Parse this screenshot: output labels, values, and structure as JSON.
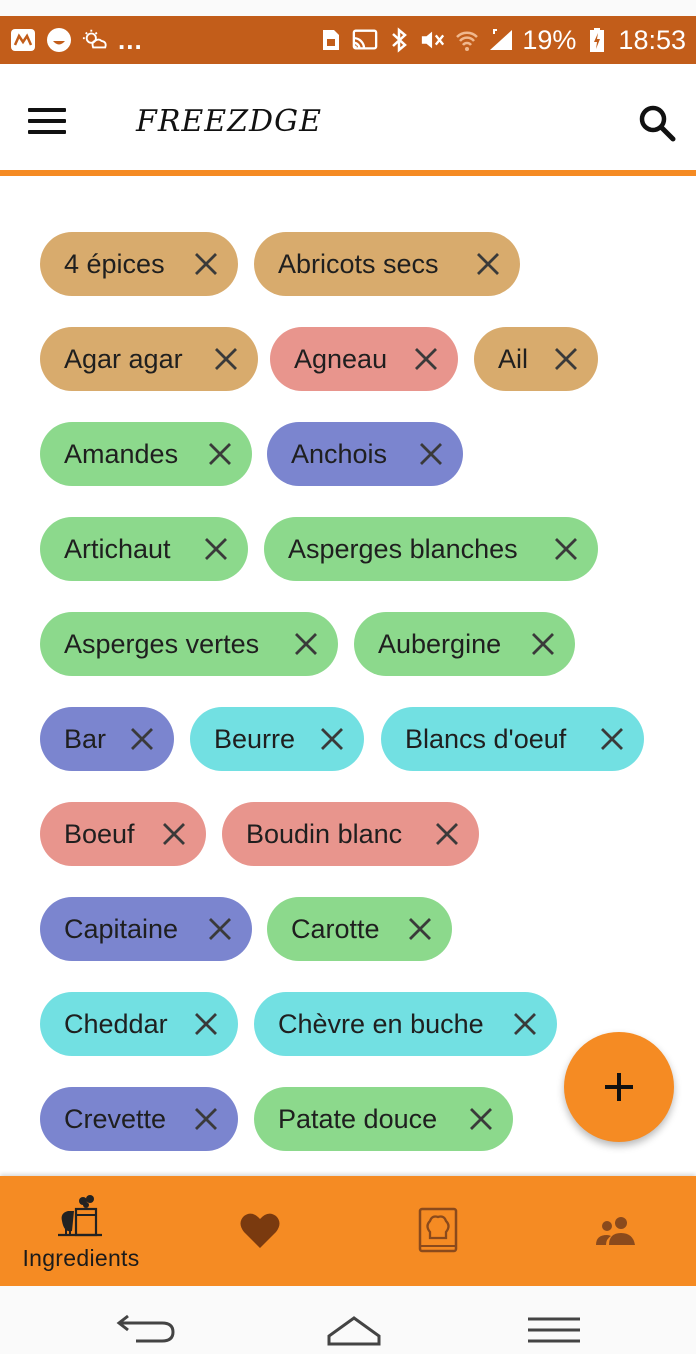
{
  "status_bar": {
    "overflow_dots": "...",
    "battery": "19%",
    "time": "18:53"
  },
  "app_bar": {
    "title": "FREEZDGE",
    "menu_icon": "hamburger-menu-icon",
    "search_icon": "search-icon"
  },
  "ingredients": [
    {
      "label": "4 épices",
      "color": "#d8ab6d"
    },
    {
      "label": "Abricots secs",
      "color": "#d8ab6d"
    },
    {
      "label": "Agar agar",
      "color": "#d8ab6d"
    },
    {
      "label": "Agneau",
      "color": "#e8958d"
    },
    {
      "label": "Ail",
      "color": "#d8ab6d"
    },
    {
      "label": "Amandes",
      "color": "#8cd98c"
    },
    {
      "label": "Anchois",
      "color": "#7b85cf"
    },
    {
      "label": "Artichaut",
      "color": "#8cd98c"
    },
    {
      "label": "Asperges blanches",
      "color": "#8cd98c"
    },
    {
      "label": "Asperges vertes",
      "color": "#8cd98c"
    },
    {
      "label": "Aubergine",
      "color": "#8cd98c"
    },
    {
      "label": "Bar",
      "color": "#7b85cf"
    },
    {
      "label": "Beurre",
      "color": "#72e0e2"
    },
    {
      "label": "Blancs d'oeuf",
      "color": "#72e0e2"
    },
    {
      "label": "Boeuf",
      "color": "#e8958d"
    },
    {
      "label": "Boudin blanc",
      "color": "#e8958d"
    },
    {
      "label": "Capitaine",
      "color": "#7b85cf"
    },
    {
      "label": "Carotte",
      "color": "#8cd98c"
    },
    {
      "label": "Cheddar",
      "color": "#72e0e2"
    },
    {
      "label": "Chèvre en buche",
      "color": "#72e0e2"
    },
    {
      "label": "Crevette",
      "color": "#7b85cf"
    },
    {
      "label": "Patate douce",
      "color": "#8cd98c"
    }
  ],
  "fab": {
    "icon": "plus-icon"
  },
  "bottom_nav": {
    "active": "Ingredients",
    "items": [
      {
        "label": "Ingredients",
        "icon": "ingredients-icon"
      },
      {
        "label": "",
        "icon": "heart-icon"
      },
      {
        "label": "",
        "icon": "recipe-book-icon"
      },
      {
        "label": "",
        "icon": "people-icon"
      }
    ]
  },
  "system_nav": {
    "back_icon": "back-icon",
    "home_icon": "home-icon",
    "recents_icon": "recents-icon"
  },
  "colors": {
    "accent": "#f58b23",
    "status_bar": "#c25d1a"
  }
}
